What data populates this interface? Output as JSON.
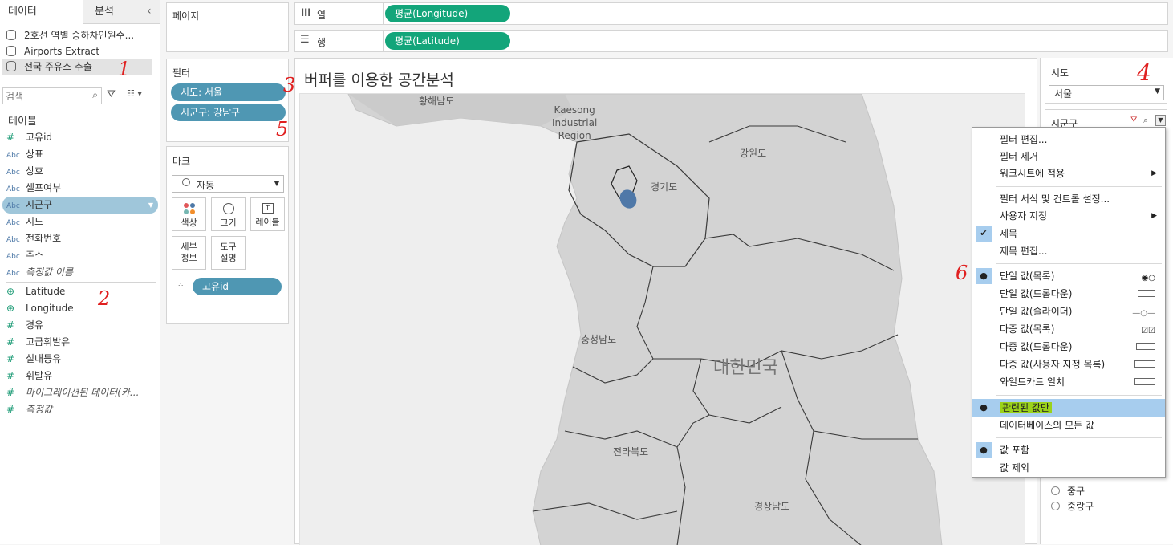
{
  "data_pane": {
    "tabs": [
      {
        "label": "데이터"
      },
      {
        "label": "분석"
      }
    ],
    "collapse_icon": "chevron-left-icon",
    "datasources": [
      {
        "label": "2호선 역별 승하차인원수..."
      },
      {
        "label": "Airports Extract"
      },
      {
        "label": "전국 주유소 추출"
      }
    ],
    "search_placeholder": "검색",
    "tables_header": "테이블",
    "dimensions": [
      {
        "type": "#",
        "label": "고유id"
      },
      {
        "type": "Abc",
        "label": "상표"
      },
      {
        "type": "Abc",
        "label": "상호"
      },
      {
        "type": "Abc",
        "label": "셀프여부"
      },
      {
        "type": "Abc",
        "label": "시군구"
      },
      {
        "type": "Abc",
        "label": "시도"
      },
      {
        "type": "Abc",
        "label": "전화번호"
      },
      {
        "type": "Abc",
        "label": "주소"
      },
      {
        "type": "Abc",
        "label": "측정값 이름"
      }
    ],
    "measures": [
      {
        "type": "geo",
        "label": "Latitude"
      },
      {
        "type": "geo",
        "label": "Longitude"
      },
      {
        "type": "#",
        "label": "경유"
      },
      {
        "type": "#",
        "label": "고급휘발유"
      },
      {
        "type": "#",
        "label": "실내등유"
      },
      {
        "type": "#",
        "label": "휘발유"
      },
      {
        "type": "#",
        "label": "마이그레이션된 데이터(카..."
      },
      {
        "type": "#",
        "label": "측정값"
      }
    ]
  },
  "pages_shelf": {
    "title": "페이지"
  },
  "columns_shelf": {
    "label": "열",
    "pill": "평균(Longitude)"
  },
  "rows_shelf": {
    "label": "행",
    "pill": "평균(Latitude)"
  },
  "filters_shelf": {
    "title": "필터",
    "pills": [
      "시도: 서울",
      "시군구: 강남구"
    ]
  },
  "marks_card": {
    "title": "마크",
    "mark_type": "자동",
    "buttons": [
      "색상",
      "크기",
      "레이블",
      "세부\n정보",
      "도구\n설명"
    ],
    "detail_pill": "고유id"
  },
  "worksheet": {
    "title": "버퍼를 이용한 공간분석",
    "map_labels": [
      {
        "key": "hwanghae",
        "text": "황해남도"
      },
      {
        "key": "kaesong",
        "text": "Kaesong\nIndustrial\nRegion"
      },
      {
        "key": "gangwon",
        "text": "강원도"
      },
      {
        "key": "gyeonggi",
        "text": "경기도"
      },
      {
        "key": "chungnam",
        "text": "충청남도"
      },
      {
        "key": "korea",
        "text": "대한민국"
      },
      {
        "key": "jeonbuk",
        "text": "전라북도"
      },
      {
        "key": "gyeongnam",
        "text": "경상남도"
      }
    ]
  },
  "filter_cards": {
    "sido": {
      "title": "시도",
      "value": "서울"
    },
    "sigungu": {
      "title": "시군구",
      "visible_items": [
        "중구",
        "중랑구"
      ]
    }
  },
  "context_menu": {
    "items": [
      {
        "label": "필터 편집..."
      },
      {
        "label": "필터 제거"
      },
      {
        "label": "워크시트에 적용",
        "submenu": true
      },
      {
        "label": "필터 서식 및 컨트롤 설정..."
      },
      {
        "label": "사용자 지정",
        "submenu": true
      },
      {
        "label": "제목",
        "check": true
      },
      {
        "label": "제목 편집..."
      },
      {
        "label": "단일 값(목록)",
        "bullet": true,
        "icon": "single-list-icon"
      },
      {
        "label": "단일 값(드롭다운)",
        "icon": "dropdown-icon"
      },
      {
        "label": "단일 값(슬라이더)",
        "icon": "slider-icon"
      },
      {
        "label": "다중 값(목록)",
        "icon": "multi-list-icon"
      },
      {
        "label": "다중 값(드롭다운)",
        "icon": "multi-dropdown-icon"
      },
      {
        "label": "다중 값(사용자 지정 목록)",
        "icon": "custom-list-icon"
      },
      {
        "label": "와일드카드 일치",
        "icon": "wildcard-icon"
      },
      {
        "label": "관련된 값만",
        "bullet": true,
        "highlight": true
      },
      {
        "label": "데이터베이스의 모든 값"
      },
      {
        "label": "값 포함",
        "bullet": true
      },
      {
        "label": "값 제외"
      }
    ]
  },
  "annotations": [
    "1",
    "2",
    "3",
    "4",
    "5",
    "6"
  ],
  "colors": {
    "pill_green": "#13a57a",
    "pill_blue": "#4f97b3",
    "menu_highlight": "#a7cdee",
    "annotation": "#e02020"
  }
}
